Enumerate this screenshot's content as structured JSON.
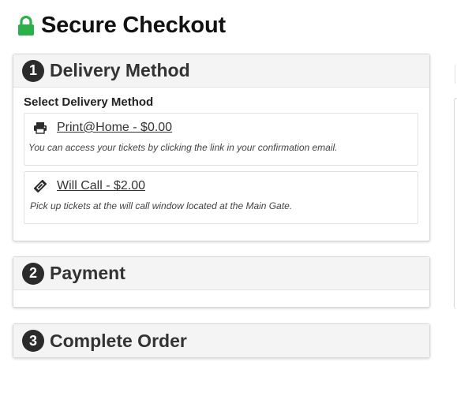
{
  "header": {
    "title": "Secure Checkout",
    "icon": "lock-icon",
    "icon_color": "#2bb14a"
  },
  "steps": [
    {
      "number": "1",
      "title": "Delivery Method",
      "section_label": "Select Delivery Method",
      "options": [
        {
          "icon": "printer-icon",
          "label": "Print@Home - $0.00",
          "description": "You can access your tickets by clicking the link in your confirmation email."
        },
        {
          "icon": "ticket-icon",
          "label": "Will Call - $2.00",
          "description": "Pick up tickets at the will call window located at the Main Gate."
        }
      ]
    },
    {
      "number": "2",
      "title": "Payment"
    },
    {
      "number": "3",
      "title": "Complete Order"
    }
  ]
}
